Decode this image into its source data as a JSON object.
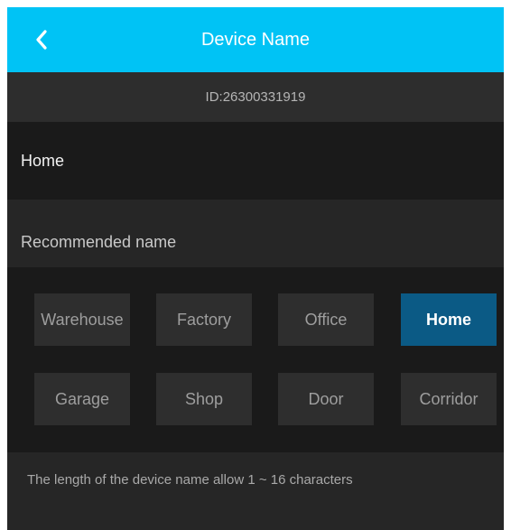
{
  "header": {
    "title": "Device Name",
    "back_icon": "chevron-left-icon",
    "background_color": "#00c3f5"
  },
  "device": {
    "id_text": "ID:26300331919"
  },
  "name_field": {
    "value": "Home"
  },
  "recommended": {
    "label": "Recommended name",
    "options": [
      {
        "label": "Warehouse",
        "selected": false
      },
      {
        "label": "Factory",
        "selected": false
      },
      {
        "label": "Office",
        "selected": false
      },
      {
        "label": "Home",
        "selected": true
      },
      {
        "label": "Garage",
        "selected": false
      },
      {
        "label": "Shop",
        "selected": false
      },
      {
        "label": "Door",
        "selected": false
      },
      {
        "label": "Corridor",
        "selected": false
      }
    ],
    "selected_color": "#0b5a85"
  },
  "footer": {
    "hint": "The length of the device name allow 1 ~ 16 characters"
  }
}
